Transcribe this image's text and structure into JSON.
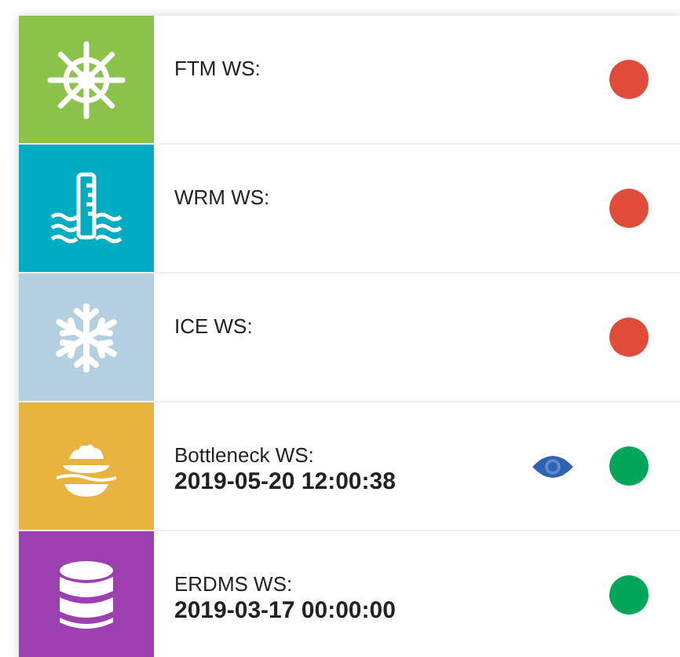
{
  "services": [
    {
      "kind": "wheel",
      "label": "FTM WS:",
      "viewable": false,
      "color": "#e04b3a"
    },
    {
      "kind": "gauge",
      "label": "WRM WS:",
      "viewable": false,
      "color": "#e04b3a"
    },
    {
      "kind": "snowflake",
      "label": "ICE WS:",
      "viewable": false,
      "color": "#e04b3a"
    },
    {
      "kind": "ship",
      "label": "Bottleneck WS:",
      "timestamp": "2019-05-20 12:00:38",
      "viewable": true,
      "color": "#00a65a"
    },
    {
      "kind": "database",
      "label": "ERDMS WS:",
      "timestamp": "2019-03-17 00:00:00",
      "viewable": false,
      "color": "#00a65a"
    }
  ]
}
